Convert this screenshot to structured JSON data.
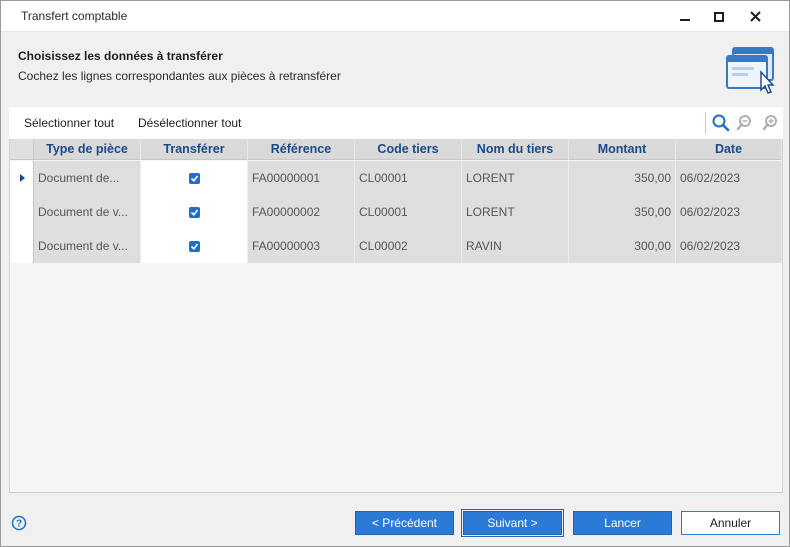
{
  "window": {
    "title": "Transfert comptable"
  },
  "header": {
    "title": "Choisissez les données à transférer",
    "subtitle": "Cochez les lignes correspondantes aux pièces à retransférer",
    "icon": "window-cursor-icon"
  },
  "toolbar": {
    "select_all": "Sélectionner tout",
    "deselect_all": "Désélectionner tout",
    "icons": [
      "search-icon",
      "zoom-out-icon",
      "zoom-in-icon"
    ]
  },
  "grid": {
    "columns": [
      "Type de pièce",
      "Transférer",
      "Référence",
      "Code tiers",
      "Nom du tiers",
      "Montant",
      "Date"
    ],
    "rows": [
      {
        "type": "Document de...",
        "transfer": true,
        "reference": "FA00000001",
        "code_tiers": "CL00001",
        "nom_tiers": "LORENT",
        "montant": "350,00",
        "date": "06/02/2023",
        "current": true
      },
      {
        "type": "Document de v...",
        "transfer": true,
        "reference": "FA00000002",
        "code_tiers": "CL00001",
        "nom_tiers": "LORENT",
        "montant": "350,00",
        "date": "06/02/2023",
        "current": false
      },
      {
        "type": "Document de v...",
        "transfer": true,
        "reference": "FA00000003",
        "code_tiers": "CL00002",
        "nom_tiers": "RAVIN",
        "montant": "300,00",
        "date": "06/02/2023",
        "current": false
      }
    ]
  },
  "footer": {
    "previous": "< Précédent",
    "next": "Suivant >",
    "cancel": "Lancer",
    "abort": "Annuler"
  },
  "colors": {
    "accent": "#2b7ad6",
    "header_text": "#1a4a8a"
  }
}
